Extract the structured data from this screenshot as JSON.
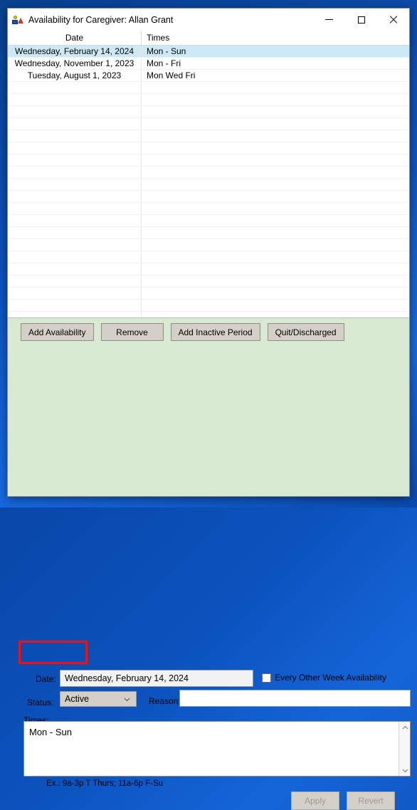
{
  "window": {
    "title": "Availability for Caregiver: Allan Grant",
    "icon": "caregiver-contacts-icon",
    "controls": {
      "minimize": "minimize-icon",
      "maximize": "maximize-icon",
      "close": "close-icon"
    }
  },
  "list": {
    "columns": [
      "Date",
      "Times"
    ],
    "rows": [
      {
        "date": "Wednesday, February 14, 2024",
        "times": "Mon - Sun",
        "selected": true
      },
      {
        "date": "Wednesday, November 1, 2023",
        "times": "Mon - Fri",
        "selected": false
      },
      {
        "date": "Tuesday, August 1, 2023",
        "times": "Mon Wed Fri",
        "selected": false
      }
    ],
    "empty_row_count": 20,
    "selection_color": "#cde8f7"
  },
  "panel": {
    "background_color": "#d9ead3",
    "buttons": {
      "add_availability": "Add Availability",
      "remove": "Remove",
      "add_inactive_period": "Add Inactive Period",
      "quit_discharged": "Quit/Discharged"
    },
    "highlight": {
      "target": "Add Availability",
      "color": "#ee1111"
    },
    "fields": {
      "date_label": "Date:",
      "date_value": "Wednesday, February 14, 2024",
      "every_other_week_label": "Every Other Week Availability",
      "every_other_week_checked": false,
      "status_label": "Status:",
      "status_value": "Active",
      "status_chevron": "chevron-down-icon",
      "reason_label": "Reason:",
      "reason_value": "",
      "times_label": "Times:",
      "times_value": "Mon - Sun",
      "times_hint": "Ex.: 9a-3p T Thurs; 11a-6p F-Su"
    },
    "footer": {
      "apply": "Apply",
      "revert": "Revert",
      "apply_enabled": false,
      "revert_enabled": false
    }
  }
}
